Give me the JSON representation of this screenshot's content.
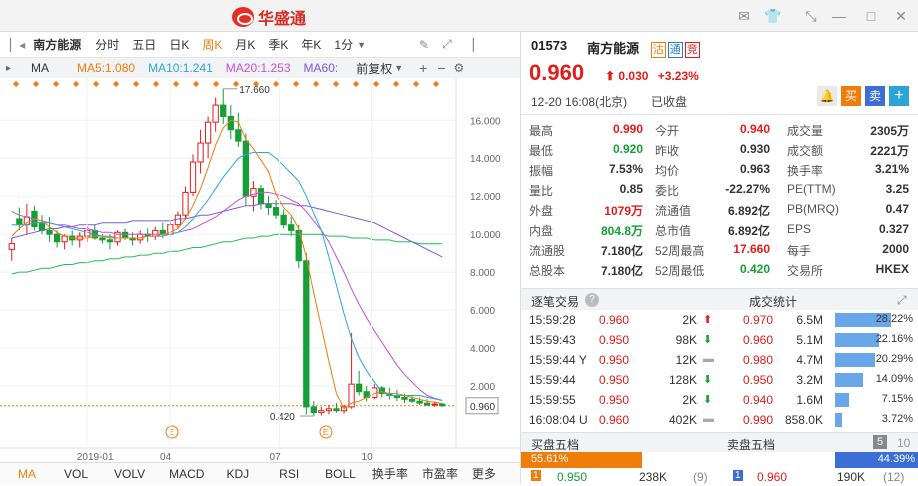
{
  "app": {
    "name": "华盛通"
  },
  "toolbar": {
    "stock_name": "南方能源",
    "periods": [
      "分时",
      "五日",
      "日K",
      "周K",
      "月K",
      "季K",
      "年K"
    ],
    "active_period": "周K",
    "interval": "1分"
  },
  "ma_line": {
    "label": "MA",
    "ma5": "MA5:1.080",
    "ma10": "MA10:1.241",
    "ma20": "MA20:1.253",
    "ma60": "MA60:",
    "adjust": "前复权"
  },
  "colors": {
    "up": "#e41b1b",
    "down": "#159f36",
    "ma5": "#f07c0a",
    "ma10": "#2aa6d6",
    "ma20": "#c94fd4",
    "ma60": "#7b5ad8",
    "ma120": "#1fbf5a"
  },
  "chart_data": {
    "type": "candlestick",
    "y_ticks": [
      "16.000",
      "14.000",
      "12.000",
      "10.000",
      "8.000",
      "6.000",
      "4.000",
      "2.000",
      "0.960"
    ],
    "x_ticks": [
      "2019-01",
      "04",
      "07",
      "10"
    ],
    "high_label": "17.660",
    "low_label": "0.420",
    "last_price": "0.960",
    "ylim": [
      0,
      17.7
    ],
    "candles": [
      [
        9.2,
        9.8,
        8.6,
        9.5
      ],
      [
        10.8,
        11.4,
        10.2,
        10.5
      ],
      [
        10.5,
        11.6,
        10.0,
        10.9
      ],
      [
        11.2,
        11.5,
        10.2,
        10.4
      ],
      [
        10.6,
        11.0,
        10.0,
        10.2
      ],
      [
        10.2,
        10.9,
        9.6,
        10.0
      ],
      [
        10.0,
        10.2,
        9.3,
        9.6
      ],
      [
        9.6,
        10.0,
        9.2,
        9.9
      ],
      [
        9.9,
        10.2,
        9.4,
        9.7
      ],
      [
        9.7,
        10.1,
        9.3,
        9.9
      ],
      [
        9.9,
        10.4,
        9.6,
        10.2
      ],
      [
        10.2,
        10.5,
        9.7,
        9.8
      ],
      [
        9.8,
        10.0,
        9.5,
        9.7
      ],
      [
        9.7,
        10.0,
        9.2,
        9.6
      ],
      [
        9.6,
        10.2,
        9.4,
        10.1
      ],
      [
        10.1,
        10.3,
        9.7,
        9.8
      ],
      [
        9.8,
        10.1,
        9.4,
        9.7
      ],
      [
        9.7,
        10.2,
        9.5,
        10.0
      ],
      [
        10.0,
        10.3,
        9.6,
        9.9
      ],
      [
        9.9,
        10.4,
        9.7,
        10.2
      ],
      [
        10.2,
        10.6,
        9.8,
        10.0
      ],
      [
        10.0,
        10.7,
        9.9,
        10.5
      ],
      [
        10.5,
        11.2,
        10.3,
        11.0
      ],
      [
        11.0,
        12.5,
        10.8,
        12.2
      ],
      [
        12.2,
        14.2,
        12.0,
        13.8
      ],
      [
        13.8,
        15.5,
        13.2,
        14.8
      ],
      [
        14.8,
        16.2,
        14.0,
        15.9
      ],
      [
        15.9,
        17.2,
        15.4,
        16.8
      ],
      [
        16.8,
        17.66,
        15.8,
        16.2
      ],
      [
        16.2,
        16.8,
        15.0,
        15.5
      ],
      [
        15.5,
        16.4,
        14.6,
        14.9
      ],
      [
        14.9,
        15.3,
        11.5,
        12.0
      ],
      [
        12.0,
        12.8,
        11.2,
        12.4
      ],
      [
        12.4,
        12.6,
        11.3,
        11.6
      ],
      [
        11.6,
        12.0,
        11.0,
        11.4
      ],
      [
        11.4,
        11.8,
        10.8,
        11.0
      ],
      [
        11.0,
        11.3,
        10.3,
        10.5
      ],
      [
        10.5,
        10.9,
        9.9,
        10.2
      ],
      [
        10.2,
        10.5,
        8.2,
        8.6
      ],
      [
        8.6,
        9.0,
        0.5,
        0.9
      ],
      [
        0.9,
        1.2,
        0.42,
        0.6
      ],
      [
        0.6,
        0.9,
        0.45,
        0.7
      ],
      [
        0.7,
        1.0,
        0.5,
        0.8
      ],
      [
        0.8,
        1.1,
        0.6,
        0.7
      ],
      [
        0.7,
        1.0,
        0.55,
        0.9
      ],
      [
        0.9,
        4.8,
        0.8,
        2.1
      ],
      [
        2.1,
        2.8,
        1.5,
        1.7
      ],
      [
        1.7,
        2.0,
        1.2,
        1.4
      ],
      [
        1.4,
        2.1,
        1.3,
        1.9
      ],
      [
        1.9,
        2.0,
        1.4,
        1.6
      ],
      [
        1.6,
        1.9,
        1.3,
        1.5
      ],
      [
        1.5,
        1.8,
        1.2,
        1.4
      ],
      [
        1.4,
        1.6,
        1.1,
        1.3
      ],
      [
        1.3,
        1.5,
        1.1,
        1.2
      ],
      [
        1.2,
        1.4,
        1.0,
        1.1
      ],
      [
        1.1,
        1.3,
        0.95,
        1.0
      ],
      [
        1.0,
        1.2,
        0.9,
        1.05
      ],
      [
        1.05,
        1.1,
        0.9,
        0.96
      ]
    ],
    "ma5": [
      9.9,
      10.3,
      10.6,
      10.8,
      10.7,
      10.4,
      10.1,
      9.9,
      9.8,
      9.8,
      9.8,
      9.9,
      9.9,
      9.8,
      9.8,
      9.8,
      9.8,
      9.8,
      9.9,
      9.9,
      10.0,
      10.1,
      10.3,
      10.8,
      11.5,
      12.4,
      13.5,
      14.7,
      15.6,
      16.0,
      15.9,
      15.0,
      14.5,
      13.9,
      13.3,
      12.1,
      11.4,
      11.0,
      10.3,
      8.8,
      6.9,
      5.1,
      3.3,
      1.6,
      0.8,
      1.1,
      1.2,
      1.4,
      1.6,
      1.7,
      1.6,
      1.6,
      1.5,
      1.4,
      1.3,
      1.2,
      1.15,
      1.08
    ],
    "ma10": [
      10.5,
      10.5,
      10.5,
      10.6,
      10.6,
      10.6,
      10.5,
      10.4,
      10.3,
      10.2,
      10.1,
      10.0,
      9.9,
      9.9,
      9.8,
      9.8,
      9.8,
      9.8,
      9.9,
      9.9,
      9.9,
      10.0,
      10.1,
      10.4,
      10.8,
      11.3,
      11.8,
      12.4,
      13.0,
      13.5,
      14.0,
      14.2,
      14.3,
      14.3,
      14.3,
      14.0,
      13.6,
      13.2,
      12.8,
      12.0,
      11.1,
      10.2,
      8.8,
      7.3,
      5.8,
      4.5,
      3.5,
      2.8,
      2.2,
      1.7,
      1.5,
      1.5,
      1.5,
      1.5,
      1.5,
      1.4,
      1.32,
      1.24
    ],
    "ma20": [
      11.2,
      11.0,
      10.9,
      10.8,
      10.7,
      10.6,
      10.5,
      10.5,
      10.4,
      10.3,
      10.3,
      10.2,
      10.1,
      10.1,
      10.0,
      10.0,
      10.0,
      10.0,
      10.0,
      10.0,
      10.0,
      10.0,
      10.1,
      10.2,
      10.3,
      10.5,
      10.7,
      10.9,
      11.2,
      11.5,
      11.8,
      12.0,
      12.1,
      12.2,
      12.2,
      12.1,
      12.0,
      11.8,
      11.6,
      11.2,
      10.7,
      10.2,
      9.6,
      8.8,
      8.0,
      7.1,
      6.3,
      5.6,
      4.9,
      4.3,
      3.7,
      3.1,
      2.6,
      2.2,
      1.8,
      1.5,
      1.35,
      1.25
    ],
    "ma60": [
      9.8,
      9.9,
      10.0,
      10.1,
      10.2,
      10.3,
      10.3,
      10.4,
      10.4,
      10.5,
      10.5,
      10.5,
      10.6,
      10.6,
      10.6,
      10.6,
      10.7,
      10.7,
      10.7,
      10.7,
      10.7,
      10.7,
      10.8,
      10.8,
      10.9,
      11.0,
      11.0,
      11.1,
      11.2,
      11.3,
      11.4,
      11.5,
      11.5,
      11.6,
      11.6,
      11.6,
      11.6,
      11.6,
      11.5,
      11.5,
      11.4,
      11.3,
      11.2,
      11.1,
      11.0,
      10.9,
      10.8,
      10.7,
      10.6,
      10.4,
      10.2,
      10.0,
      9.8,
      9.6,
      9.4,
      9.2,
      9.0,
      8.8
    ],
    "ma120": [
      7.9,
      8.0,
      8.0,
      8.1,
      8.2,
      8.2,
      8.3,
      8.4,
      8.4,
      8.5,
      8.5,
      8.6,
      8.6,
      8.7,
      8.7,
      8.8,
      8.8,
      8.9,
      8.9,
      9.0,
      9.0,
      9.1,
      9.1,
      9.2,
      9.3,
      9.3,
      9.4,
      9.5,
      9.6,
      9.6,
      9.7,
      9.8,
      9.8,
      9.9,
      9.9,
      10.0,
      10.0,
      10.0,
      10.0,
      10.0,
      10.0,
      10.0,
      9.9,
      9.9,
      9.9,
      9.8,
      9.8,
      9.8,
      9.7,
      9.7,
      9.7,
      9.6,
      9.6,
      9.6,
      9.5,
      9.5,
      9.5,
      9.5
    ]
  },
  "bottom_tabs": [
    "MA",
    "VOL",
    "VOLV",
    "MACD",
    "KDJ",
    "RSI",
    "BOLL",
    "换手率",
    "市盈率",
    "更多"
  ],
  "quote": {
    "code": "01573",
    "name": "南方能源",
    "tags": [
      "沽",
      "通",
      "竞"
    ],
    "price": "0.960",
    "change": "0.030",
    "change_pct": "+3.23%",
    "date": "12-20",
    "time": "16:08(北京)",
    "status": "已收盘",
    "buy": "买",
    "sell": "卖",
    "add": "+"
  },
  "quote_table": [
    [
      "最高",
      "0.990",
      "red",
      "今开",
      "0.940",
      "red",
      "成交量",
      "2305万",
      ""
    ],
    [
      "最低",
      "0.920",
      "green",
      "昨收",
      "0.930",
      "",
      "成交额",
      "2221万",
      ""
    ],
    [
      "振幅",
      "7.53%",
      "",
      "均价",
      "0.963",
      "",
      "换手率",
      "3.21%",
      ""
    ],
    [
      "量比",
      "0.85",
      "",
      "委比",
      "-22.27%",
      "",
      "PE(TTM)",
      "3.25",
      ""
    ],
    [
      "外盘",
      "1079万",
      "red",
      "流通值",
      "6.892亿",
      "",
      "PB(MRQ)",
      "0.47",
      ""
    ],
    [
      "内盘",
      "804.8万",
      "green",
      "总市值",
      "6.892亿",
      "",
      "EPS",
      "0.327",
      ""
    ],
    [
      "流通股",
      "7.180亿",
      "",
      "52周最高",
      "17.660",
      "red",
      "每手",
      "2000",
      ""
    ],
    [
      "总股本",
      "7.180亿",
      "",
      "52周最低",
      "0.420",
      "green",
      "交易所",
      "HKEX",
      ""
    ]
  ],
  "trades": {
    "title": "逐笔交易",
    "stats_title": "成交统计",
    "rows": [
      [
        "15:59:28",
        "0.960",
        "2K",
        "up",
        "0.970",
        "6.5M",
        "28.22%",
        0.2822
      ],
      [
        "15:59:43",
        "0.950",
        "98K",
        "down",
        "0.960",
        "5.1M",
        "22.16%",
        0.2216
      ],
      [
        "15:59:44 Y",
        "0.950",
        "12K",
        "flat",
        "0.980",
        "4.7M",
        "20.29%",
        0.2029
      ],
      [
        "15:59:44",
        "0.950",
        "128K",
        "down",
        "0.950",
        "3.2M",
        "14.09%",
        0.1409
      ],
      [
        "15:59:55",
        "0.950",
        "2K",
        "down",
        "0.940",
        "1.6M",
        "7.15%",
        0.0715
      ],
      [
        "16:08:04 U",
        "0.960",
        "402K",
        "flat",
        "0.990",
        "858.0K",
        "3.72%",
        0.0372
      ]
    ]
  },
  "orderbook": {
    "bid_title": "买盘五档",
    "ask_title": "卖盘五档",
    "level": "5",
    "level_alt": "10",
    "bid_pct": "55.61%",
    "ask_pct": "44.39%",
    "bid_fraction": 0.5561,
    "bid_row": {
      "lv": "1",
      "price": "0.950",
      "vol": "238K",
      "cnt": "(9)"
    },
    "ask_row": {
      "lv": "1",
      "price": "0.960",
      "vol": "190K",
      "cnt": "(12)"
    }
  }
}
